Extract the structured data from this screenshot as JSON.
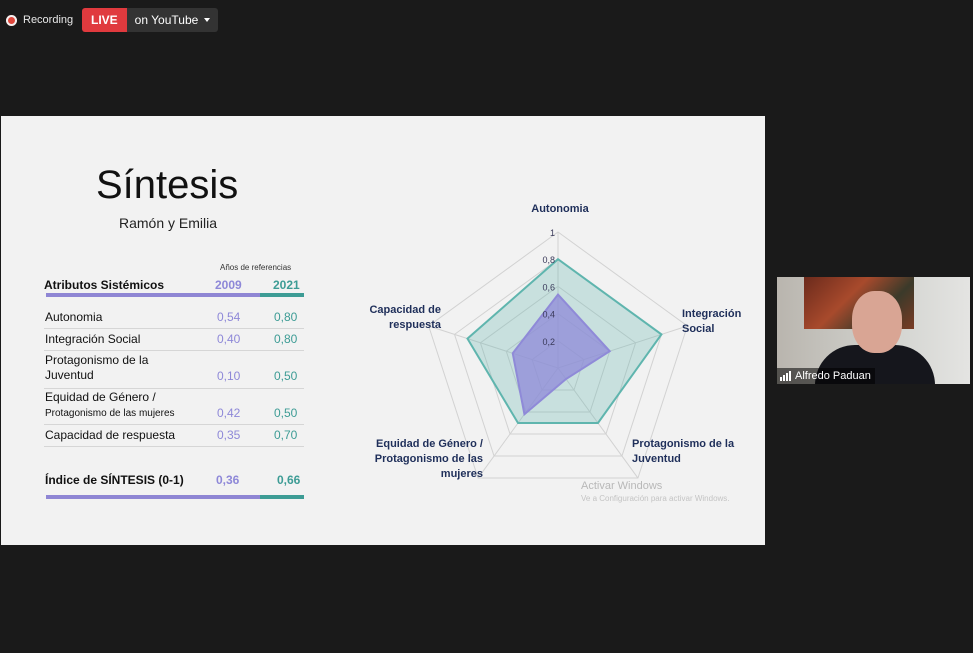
{
  "topbar": {
    "recording_label": "Recording",
    "live_label": "LIVE",
    "stream_label": "on YouTube"
  },
  "slide": {
    "title": "Síntesis",
    "subtitle": "Ramón y Emilia",
    "table": {
      "reference_label": "Años de referencias",
      "header_attr": "Atributos Sistémicos",
      "year1": "2009",
      "year2": "2021",
      "rows": [
        {
          "label": "Autonomia",
          "v2009": "0,54",
          "v2021": "0,80"
        },
        {
          "label": "Integración Social",
          "v2009": "0,40",
          "v2021": "0,80"
        },
        {
          "label_line1": "Protagonismo de la",
          "label_line2": "Juventud",
          "v2009": "0,10",
          "v2021": "0,50"
        },
        {
          "label_line1": "Equidad de Género /",
          "label_line2": "Protagonismo de las mujeres",
          "v2009": "0,42",
          "v2021": "0,50"
        },
        {
          "label": "Capacidad de respuesta",
          "v2009": "0,35",
          "v2021": "0,70"
        }
      ],
      "index_label": "Índice de SÍNTESIS (0-1)",
      "index_2009": "0,36",
      "index_2021": "0,66"
    },
    "watermark_title": "Activar Windows",
    "watermark_text": "Ve a Configuración para activar Windows."
  },
  "chart_data": {
    "type": "radar",
    "axes": [
      "Autonomia",
      "Integración Social",
      "Protagonismo de la Juventud",
      "Equidad de Género / Protagonismo de las mujeres",
      "Capacidad de respuesta"
    ],
    "axis_label_lines": [
      [
        "Autonomia"
      ],
      [
        "Integración",
        "Social"
      ],
      [
        "Protagonismo de la",
        "Juventud"
      ],
      [
        "Equidad de Género /",
        "Protagonismo de las",
        "mujeres"
      ],
      [
        "Capacidad de",
        "respuesta"
      ]
    ],
    "ticks": [
      "0,2",
      "0,4",
      "0,6",
      "0,8",
      "1"
    ],
    "tick_values": [
      0.2,
      0.4,
      0.6,
      0.8,
      1.0
    ],
    "range": [
      0,
      1
    ],
    "series": [
      {
        "values": [
          0.54,
          0.4,
          0.1,
          0.42,
          0.35
        ],
        "color": "#8f8ad8"
      },
      {
        "values": [
          0.8,
          0.8,
          0.5,
          0.5,
          0.7
        ],
        "color": "#5fb5ae"
      }
    ],
    "grid": true,
    "legend": "none"
  },
  "participant": {
    "name": "Alfredo Paduan"
  },
  "colors": {
    "accent_2009": "#8e88d8",
    "accent_2021": "#3d9c95",
    "live_red": "#e03a3e",
    "axis_label": "#1f2f5a"
  }
}
